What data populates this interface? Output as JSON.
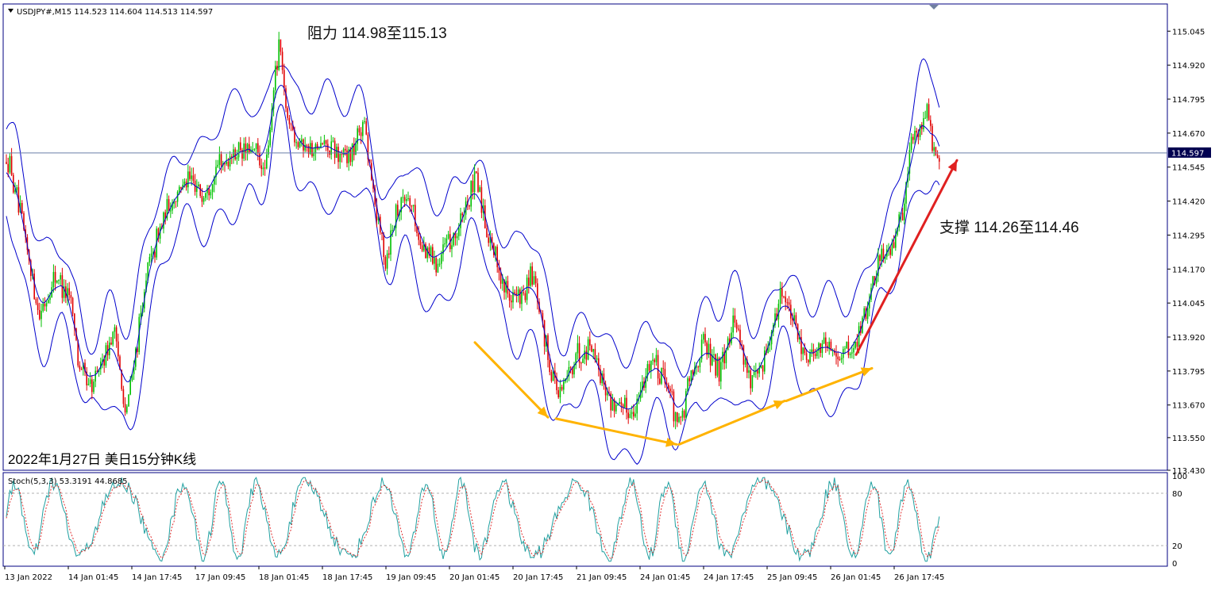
{
  "chart_data": {
    "type": "candlestick",
    "symbol_header": "USDJPY#,M15  114.523 114.604 114.513 114.597",
    "current_price_label": "114.597",
    "current_price": 114.597,
    "caption": "2022年1月27日 美日15分钟K线",
    "annotations": {
      "resistance": "阻力 114.98至115.13",
      "support": "支撑 114.26至114.46"
    },
    "y_ticks": [
      115.045,
      114.92,
      114.795,
      114.67,
      114.545,
      114.42,
      114.295,
      114.17,
      114.045,
      113.92,
      113.795,
      113.67,
      113.55,
      113.43
    ],
    "y_tick_labels": [
      "115.045",
      "114.920",
      "114.795",
      "114.670",
      "114.545",
      "114.420",
      "114.295",
      "114.170",
      "114.045",
      "113.920",
      "113.795",
      "113.670",
      "113.550",
      "113.430"
    ],
    "ylim": [
      113.43,
      115.145
    ],
    "x_tick_labels": [
      "13 Jan 2022",
      "14 Jan 01:45",
      "14 Jan 17:45",
      "17 Jan 09:45",
      "18 Jan 01:45",
      "18 Jan 17:45",
      "19 Jan 09:45",
      "20 Jan 01:45",
      "20 Jan 17:45",
      "21 Jan 09:45",
      "24 Jan 01:45",
      "24 Jan 17:45",
      "25 Jan 09:45",
      "26 Jan 01:45",
      "26 Jan 17:45"
    ],
    "price_path": [
      [
        0,
        114.5
      ],
      [
        10,
        114.58
      ],
      [
        30,
        114.3
      ],
      [
        50,
        114.0
      ],
      [
        70,
        114.15
      ],
      [
        90,
        114.05
      ],
      [
        100,
        113.8
      ],
      [
        115,
        113.72
      ],
      [
        130,
        113.85
      ],
      [
        145,
        113.95
      ],
      [
        158,
        113.62
      ],
      [
        170,
        113.85
      ],
      [
        185,
        114.15
      ],
      [
        200,
        114.3
      ],
      [
        215,
        114.42
      ],
      [
        235,
        114.5
      ],
      [
        255,
        114.45
      ],
      [
        275,
        114.55
      ],
      [
        295,
        114.6
      ],
      [
        320,
        114.6
      ],
      [
        335,
        114.52
      ],
      [
        345,
        114.85
      ],
      [
        352,
        115.0
      ],
      [
        360,
        114.75
      ],
      [
        375,
        114.65
      ],
      [
        395,
        114.6
      ],
      [
        410,
        114.62
      ],
      [
        430,
        114.58
      ],
      [
        445,
        114.6
      ],
      [
        458,
        114.72
      ],
      [
        470,
        114.45
      ],
      [
        485,
        114.2
      ],
      [
        500,
        114.4
      ],
      [
        515,
        114.45
      ],
      [
        530,
        114.25
      ],
      [
        550,
        114.2
      ],
      [
        575,
        114.3
      ],
      [
        600,
        114.5
      ],
      [
        615,
        114.3
      ],
      [
        635,
        114.1
      ],
      [
        655,
        114.05
      ],
      [
        670,
        114.15
      ],
      [
        690,
        113.85
      ],
      [
        705,
        113.7
      ],
      [
        725,
        113.85
      ],
      [
        745,
        113.9
      ],
      [
        765,
        113.7
      ],
      [
        785,
        113.65
      ],
      [
        800,
        113.66
      ],
      [
        820,
        113.85
      ],
      [
        840,
        113.75
      ],
      [
        856,
        113.58
      ],
      [
        868,
        113.75
      ],
      [
        885,
        113.9
      ],
      [
        905,
        113.8
      ],
      [
        925,
        114.0
      ],
      [
        945,
        113.75
      ],
      [
        960,
        113.8
      ],
      [
        985,
        114.1
      ],
      [
        1000,
        113.95
      ],
      [
        1015,
        113.85
      ],
      [
        1035,
        113.9
      ],
      [
        1055,
        113.85
      ],
      [
        1075,
        113.88
      ],
      [
        1090,
        114.0
      ],
      [
        1105,
        114.2
      ],
      [
        1120,
        114.25
      ],
      [
        1135,
        114.35
      ],
      [
        1148,
        114.65
      ],
      [
        1160,
        114.7
      ],
      [
        1168,
        114.78
      ],
      [
        1178,
        114.55
      ],
      [
        1185,
        114.6
      ]
    ],
    "bands_offset": 0.16,
    "arrows": [
      {
        "color": "#FFB300",
        "from": [
          598,
          113.9
        ],
        "to": [
          690,
          113.625
        ]
      },
      {
        "color": "#FFB300",
        "from": [
          700,
          113.62
        ],
        "to": [
          852,
          113.525
        ]
      },
      {
        "color": "#FFB300",
        "from": [
          855,
          113.525
        ],
        "to": [
          988,
          113.685
        ]
      },
      {
        "color": "#FFB300",
        "from": [
          990,
          113.685
        ],
        "to": [
          1098,
          113.805
        ]
      },
      {
        "color": "#E02020",
        "from": [
          1078,
          113.855
        ],
        "to": [
          1205,
          114.57
        ]
      }
    ],
    "stochastic": {
      "label": "Stoch(5,3,3) 53.3191 44.8685",
      "k": 53.3191,
      "d": 44.8685,
      "levels": [
        20,
        80
      ],
      "axis_labels": [
        "100",
        "80",
        "20",
        "0"
      ]
    },
    "colors": {
      "frame": "#000080",
      "band": "#0000CC",
      "bull": "#00C000",
      "bear": "#E00000",
      "stoch_k": "#20A0A0",
      "stoch_d": "#E03030",
      "price_line": "#6A7FA8",
      "price_badge": "#000050"
    }
  }
}
